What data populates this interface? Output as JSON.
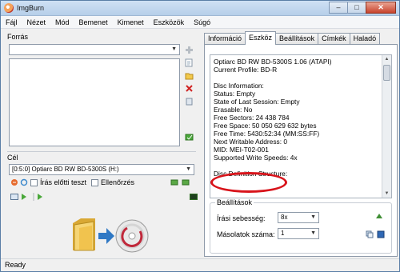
{
  "window": {
    "title": "ImgBurn"
  },
  "menu": [
    "Fájl",
    "Nézet",
    "Mód",
    "Bemenet",
    "Kimenet",
    "Eszközök",
    "Súgó"
  ],
  "source": {
    "label": "Forrás",
    "value": ""
  },
  "destination": {
    "label": "Cél",
    "drive": "[0:5:0] Optiarc BD RW BD-5300S (H:)",
    "test_write_label": "Írás előtti teszt",
    "verify_label": "Ellenőrzés"
  },
  "tabs": [
    "Információ",
    "Eszköz",
    "Beállítások",
    "Címkék",
    "Haladó"
  ],
  "active_tab": "Eszköz",
  "device_info": [
    "Optiarc BD RW BD-5300S 1.06 (ATAPI)",
    "Current Profile: BD-R",
    "",
    "Disc Information:",
    "Status: Empty",
    "State of Last Session: Empty",
    "Erasable: No",
    "Free Sectors: 24 438 784",
    "Free Space: 50 050 629 632 bytes",
    "Free Time: 5430:52:34 (MM:SS:FF)",
    "Next Writable Address: 0",
    "MID: MEI-T02-001",
    "Supported Write Speeds: 4x",
    "",
    "Disc Definition Structure:"
  ],
  "settings": {
    "title": "Beállítások",
    "write_speed_label": "Írási sebesség:",
    "write_speed_value": "8x",
    "copies_label": "Másolatok száma:",
    "copies_value": "1"
  },
  "status": {
    "text": "Ready"
  },
  "colors": {
    "highlight": "#d8141b",
    "accent": "#5a7ea6"
  }
}
